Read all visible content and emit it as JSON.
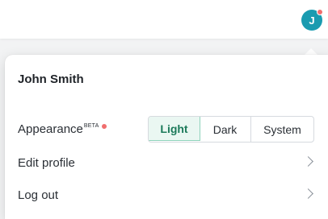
{
  "header": {
    "avatar_initial": "J",
    "avatar_color": "#1a9bb0",
    "notification_dot_color": "#f06e6e"
  },
  "menu": {
    "user_name": "John Smith",
    "appearance": {
      "label": "Appearance",
      "badge": "BETA",
      "dot_color": "#f06e6e",
      "options": [
        "Light",
        "Dark",
        "System"
      ],
      "selected": "Light",
      "selected_bg": "#eaf7f2",
      "selected_border": "#8fd3bb",
      "selected_text": "#1c7a5a"
    },
    "items": [
      {
        "label": "Edit profile",
        "icon": "chevron-right-icon"
      },
      {
        "label": "Log out",
        "icon": "chevron-right-icon"
      }
    ]
  }
}
